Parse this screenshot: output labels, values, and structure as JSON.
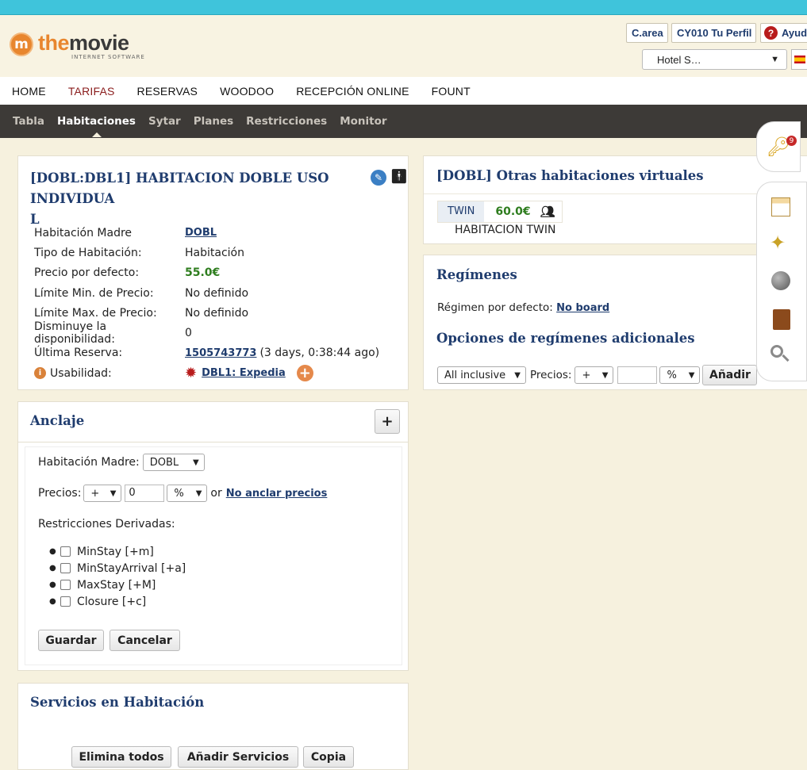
{
  "header": {
    "logo_the": "the",
    "logo_movie": "movie",
    "logo_sub": "INTERNET SOFTWARE",
    "logo_letter": "m",
    "btn_area": "C.area",
    "btn_profile": "CY010 Tu Perfil",
    "btn_help": "Ayud",
    "hotel_select": "Hotel S…",
    "colors": {
      "topbar": "#3fc4db",
      "brand": "#e8862e",
      "navy": "#1f3c6e"
    }
  },
  "mainnav": {
    "items": [
      "HOME",
      "TARIFAS",
      "RESERVAS",
      "WOODOO",
      "RECEPCIÓN ONLINE",
      "FOUNT"
    ],
    "active": "TARIFAS"
  },
  "subnav": {
    "items": [
      "Tabla",
      "Habitaciones",
      "Sytar",
      "Planes",
      "Restricciones",
      "Monitor"
    ],
    "active": "Habitaciones"
  },
  "room": {
    "title_line1": "[DOBL:DBL1] HABITACION DOBLE USO INDIVIDUA",
    "title_line2": "L",
    "rows": {
      "madre_label": "Habitación Madre",
      "madre_value": "DOBL",
      "tipo_label": "Tipo de Habitación:",
      "tipo_value": "Habitación",
      "precio_label": "Precio por defecto:",
      "precio_value": "55.0€",
      "min_label": "Límite Min. de Precio:",
      "min_value": "No definido",
      "max_label": "Límite Max. de Precio:",
      "max_value": "No definido",
      "dism_label": "Disminuye la disponibilidad:",
      "dism_value": "0",
      "ultima_label": "Última Reserva:",
      "ultima_link": "1505743773",
      "ultima_ago": "(3 days, 0:38:44 ago)",
      "usab_label": "Usabilidad:",
      "usab_link": "DBL1: Expedia"
    }
  },
  "anclaje": {
    "title": "Anclaje",
    "toggle": "+",
    "madre_label": "Habitación Madre:",
    "madre_value": "DOBL",
    "precios_label": "Precios:",
    "precios_sign": "+",
    "precios_amount": "0",
    "precios_unit": "%",
    "or_text": "or",
    "no_anclar": "No anclar precios",
    "restr_label": "Restricciones Derivadas:",
    "restrictions": [
      "MinStay [+m]",
      "MinStayArrival [+a]",
      "MaxStay [+M]",
      "Closure [+c]"
    ],
    "guardar": "Guardar",
    "cancelar": "Cancelar"
  },
  "servicios": {
    "title": "Servicios en Habitación",
    "btn_elimina": "Elimina todos",
    "btn_anadir": "Añadir Servicios",
    "btn_copia": "Copia"
  },
  "virtual": {
    "title": "[DOBL] Otras habitaciones virtuales",
    "code": "TWIN",
    "price": "60.0€",
    "name": "HABITACION TWIN"
  },
  "regimenes": {
    "title": "Regímenes",
    "default_label": "Régimen por defecto:",
    "default_value": "No board",
    "opciones_title": "Opciones de regímenes adicionales",
    "select_regimen": "All inclusive",
    "precios_label": "Precios:",
    "sign": "+",
    "unit": "%",
    "anadir": "Añadir"
  },
  "sidebar": {
    "badge": "9",
    "icons": [
      "keys-icon",
      "calendar-icon",
      "magic-wand-icon",
      "globe-icon",
      "book-icon",
      "magnifier-icon"
    ]
  }
}
